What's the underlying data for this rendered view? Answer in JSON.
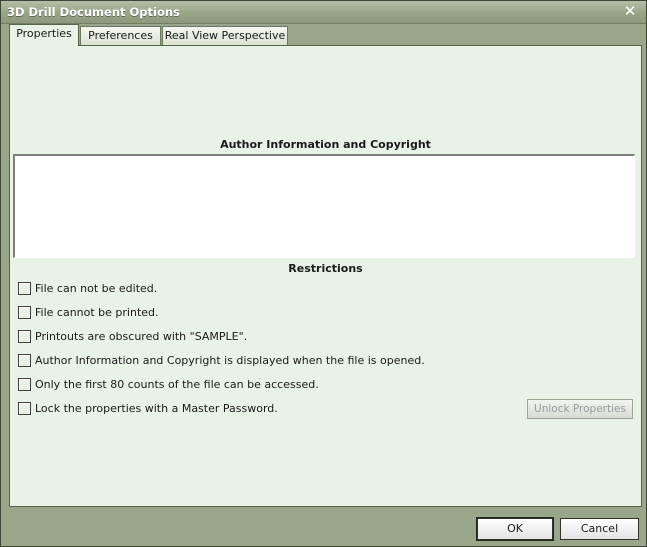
{
  "window": {
    "title": "3D Drill Document Options"
  },
  "tabs": [
    {
      "label": "Properties",
      "active": true
    },
    {
      "label": "Preferences",
      "active": false
    },
    {
      "label": "Real View Perspective",
      "active": false
    }
  ],
  "properties": {
    "author_heading": "Author Information and Copyright",
    "author_text": "",
    "restrictions_heading": "Restrictions",
    "restrictions": [
      {
        "label": "File can not be edited.",
        "checked": false
      },
      {
        "label": "File cannot be printed.",
        "checked": false
      },
      {
        "label": "Printouts are obscured with \"SAMPLE\".",
        "checked": false
      },
      {
        "label": "Author Information and Copyright is displayed when the file is opened.",
        "checked": false
      },
      {
        "label": "Only the first 80 counts of the file can be accessed.",
        "checked": false
      },
      {
        "label": "Lock the properties with a Master Password.",
        "checked": false
      }
    ],
    "unlock_button": "Unlock Properties"
  },
  "footer": {
    "ok": "OK",
    "cancel": "Cancel"
  },
  "icons": {
    "close": "close-icon"
  },
  "colors": {
    "panel_bg": "#e6f3e6",
    "frame": "#98a68a"
  }
}
